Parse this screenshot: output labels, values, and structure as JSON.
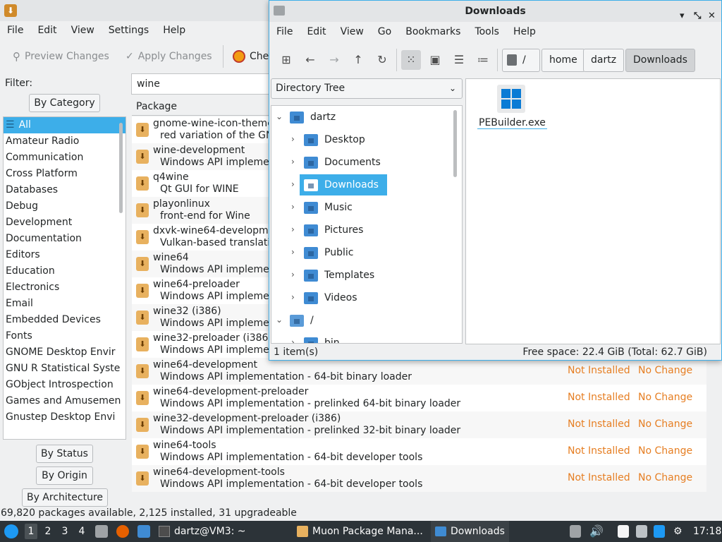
{
  "muon": {
    "menu": [
      "File",
      "Edit",
      "View",
      "Settings",
      "Help"
    ],
    "toolbar": {
      "preview": "Preview Changes",
      "apply": "Apply Changes",
      "check": "Che"
    },
    "filter_label": "Filter:",
    "search_value": "wine",
    "tabs": {
      "by_category": "By Category",
      "by_status": "By Status",
      "by_origin": "By Origin",
      "by_architecture": "By Architecture"
    },
    "categories": [
      "All",
      "Amateur Radio",
      "Communication",
      "Cross Platform",
      "Databases",
      "Debug",
      "Development",
      "Documentation",
      "Editors",
      "Education",
      "Electronics",
      "Email",
      "Embedded Devices",
      "Fonts",
      "GNOME Desktop Envir",
      "GNU R Statistical Syste",
      "GObject Introspection",
      "Games and Amusemen",
      "Gnustep Desktop Envi"
    ],
    "package_header": "Package",
    "packages": [
      {
        "name": "gnome-wine-icon-theme",
        "desc": "red variation of the GN",
        "status": "",
        "action": ""
      },
      {
        "name": "wine-development",
        "desc": "Windows API implemen",
        "status": "",
        "action": ""
      },
      {
        "name": "q4wine",
        "desc": "Qt GUI for WINE",
        "status": "",
        "action": ""
      },
      {
        "name": "playonlinux",
        "desc": "front-end for Wine",
        "status": "",
        "action": ""
      },
      {
        "name": "dxvk-wine64-developme",
        "desc": "Vulkan-based translati",
        "status": "",
        "action": ""
      },
      {
        "name": "wine64",
        "desc": "Windows API implemen",
        "status": "",
        "action": ""
      },
      {
        "name": "wine64-preloader",
        "desc": "Windows API implemen",
        "status": "",
        "action": ""
      },
      {
        "name": "wine32 (i386)",
        "desc": "Windows API implemen",
        "status": "",
        "action": ""
      },
      {
        "name": "wine32-preloader (i386)",
        "desc": "Windows API implemen",
        "status": "",
        "action": ""
      },
      {
        "name": "wine64-development",
        "desc": "Windows API implementation - 64-bit binary loader",
        "status": "Not Installed",
        "action": "No Change"
      },
      {
        "name": "wine64-development-preloader",
        "desc": "Windows API implementation - prelinked 64-bit binary loader",
        "status": "Not Installed",
        "action": "No Change"
      },
      {
        "name": "wine32-development-preloader (i386)",
        "desc": "Windows API implementation - prelinked 32-bit binary loader",
        "status": "Not Installed",
        "action": "No Change"
      },
      {
        "name": "wine64-tools",
        "desc": "Windows API implementation - 64-bit developer tools",
        "status": "Not Installed",
        "action": "No Change"
      },
      {
        "name": "wine64-development-tools",
        "desc": "Windows API implementation - 64-bit developer tools",
        "status": "Not Installed",
        "action": "No Change"
      }
    ],
    "status_bar": "69,820 packages available, 2,125 installed, 31 upgradeable"
  },
  "downloads": {
    "title": "Downloads",
    "menu": [
      "File",
      "Edit",
      "View",
      "Go",
      "Bookmarks",
      "Tools",
      "Help"
    ],
    "breadcrumbs": [
      "/",
      "home",
      "dartz",
      "Downloads"
    ],
    "panel_selector": "Directory Tree",
    "tree": {
      "home_folder": "dartz",
      "children": [
        "Desktop",
        "Documents",
        "Downloads",
        "Music",
        "Pictures",
        "Public",
        "Templates",
        "Videos"
      ],
      "root": "/",
      "root_child": "bin"
    },
    "files": [
      {
        "name": "PEBuilder.exe"
      }
    ],
    "status_left": "1 item(s)",
    "status_right": "Free space: 22.4 GiB (Total: 62.7 GiB)"
  },
  "taskbar": {
    "workspaces": [
      "1",
      "2",
      "3",
      "4"
    ],
    "terminal": "dartz@VM3: ~",
    "muon_task": "Muon Package Mana...",
    "downloads_task": "Downloads",
    "clock": "17:18"
  },
  "colors": {
    "accent": "#3daee9",
    "status_orange": "#e67e22",
    "taskbar": "#2c3338"
  }
}
